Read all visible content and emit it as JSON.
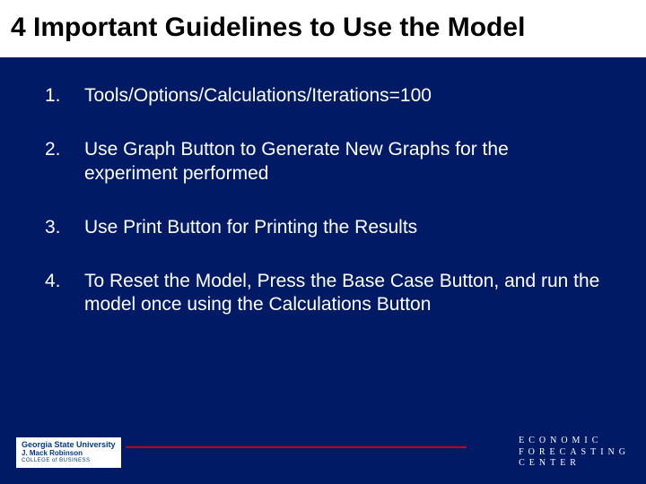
{
  "title": "4 Important Guidelines to Use the Model",
  "items": [
    {
      "num": "1.",
      "text": "Tools/Options/Calculations/Iterations=100"
    },
    {
      "num": "2.",
      "text": "Use Graph Button to Generate New Graphs for the experiment performed"
    },
    {
      "num": "3.",
      "text": "Use Print Button for Printing the Results"
    },
    {
      "num": "4.",
      "text": "To Reset the Model, Press the Base Case Button, and run the model once using the Calculations Button"
    }
  ],
  "footer": {
    "left": {
      "line1": "Georgia State University",
      "line2": "J. Mack Robinson",
      "line3": "COLLEGE of BUSINESS"
    },
    "right": {
      "line1": "ECONOMIC",
      "line2": "FORECASTING",
      "line3": "CENTER"
    }
  }
}
